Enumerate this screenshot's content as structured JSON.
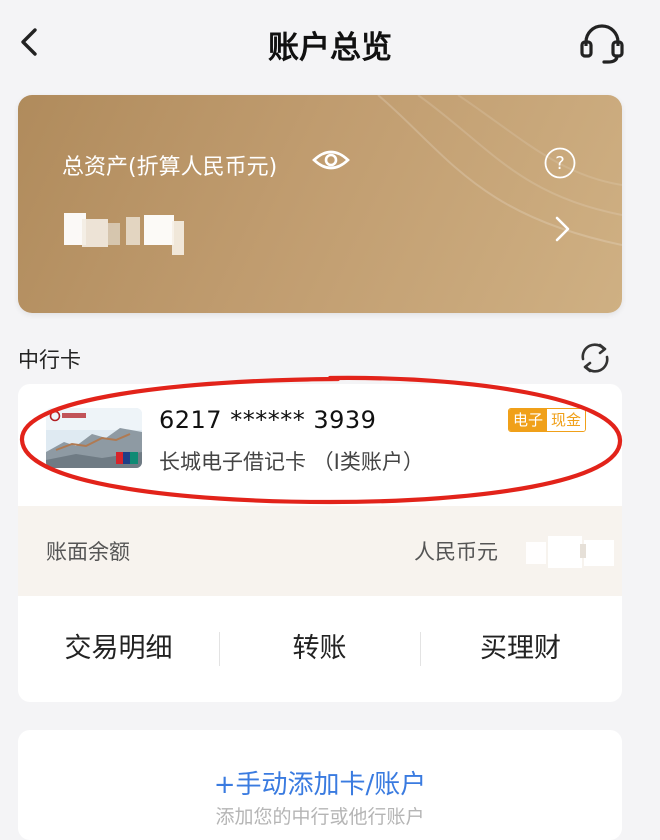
{
  "header": {
    "title": "账户总览",
    "back_icon": "chevron-left-icon",
    "service_icon": "headset-icon"
  },
  "asset_card": {
    "label": "总资产(折算人民币元)",
    "visibility_icon": "eye-icon",
    "help_icon": "question-circle-icon",
    "amount_masked": true,
    "detail_icon": "chevron-right-icon",
    "colors": {
      "gradient_start": "#b08b5c",
      "gradient_end": "#cfb083"
    }
  },
  "section": {
    "title": "中行卡",
    "refresh_icon": "refresh-icon"
  },
  "card": {
    "number": "6217 ****** 3939",
    "name": "长城电子借记卡 （I类账户）",
    "tag_part1": "电子",
    "tag_part2": "现金",
    "tag_color": "#f0a019",
    "balance_label": "账面余额",
    "balance_currency": "人民币元",
    "balance_masked": true,
    "actions": [
      "交易明细",
      "转账",
      "买理财"
    ]
  },
  "add_account": {
    "label": "+手动添加卡/账户",
    "sub_label": "添加您的中行或他行账户",
    "accent": "#3a7be0"
  }
}
